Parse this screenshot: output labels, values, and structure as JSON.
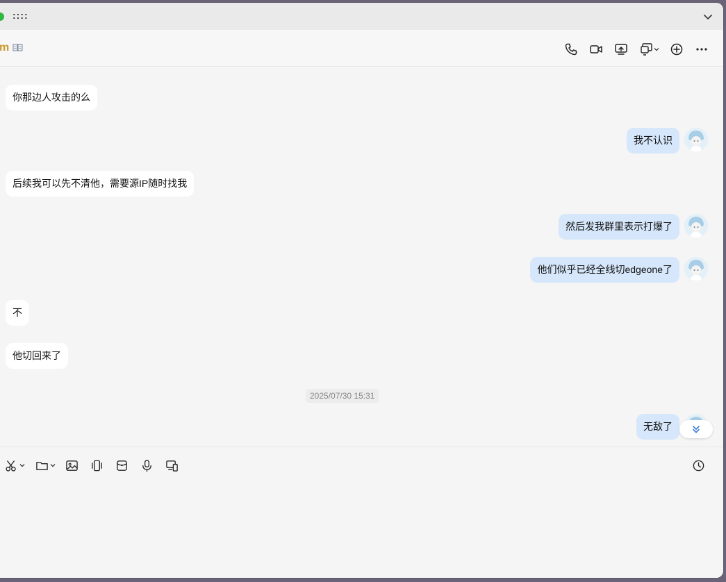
{
  "window": {
    "drag_handle": "::::"
  },
  "header": {
    "title": "m",
    "icons": [
      "phone-icon",
      "video-call-icon",
      "screen-share-icon",
      "remote-desktop-icon",
      "add-member-icon",
      "more-icon"
    ]
  },
  "messages": [
    {
      "side": "left",
      "text": "你那边人攻击的么"
    },
    {
      "side": "right",
      "text": "我不认识"
    },
    {
      "side": "left",
      "text": "后续我可以先不清他，需要源IP随时找我"
    },
    {
      "side": "right",
      "text": "然后发我群里表示打爆了"
    },
    {
      "side": "right",
      "text": "他们似乎已经全线切edgeone了"
    },
    {
      "side": "left",
      "text": "不"
    },
    {
      "side": "left",
      "text": "他切回来了"
    },
    {
      "side": "right",
      "text": "无敌了"
    }
  ],
  "timestamp": "2025/07/30 15:31",
  "composer": {
    "tools": [
      "scissors-icon",
      "folder-icon",
      "image-icon",
      "vibrate-icon",
      "red-packet-icon",
      "microphone-icon",
      "screen-icon"
    ],
    "history_icon": "clock-icon",
    "input_value": ""
  },
  "colors": {
    "title": "#c99a2e",
    "bubble_left": "#ffffff",
    "bubble_right": "#d6e7fb",
    "background": "#f5f5f5",
    "accent": "#3a7bd5"
  }
}
